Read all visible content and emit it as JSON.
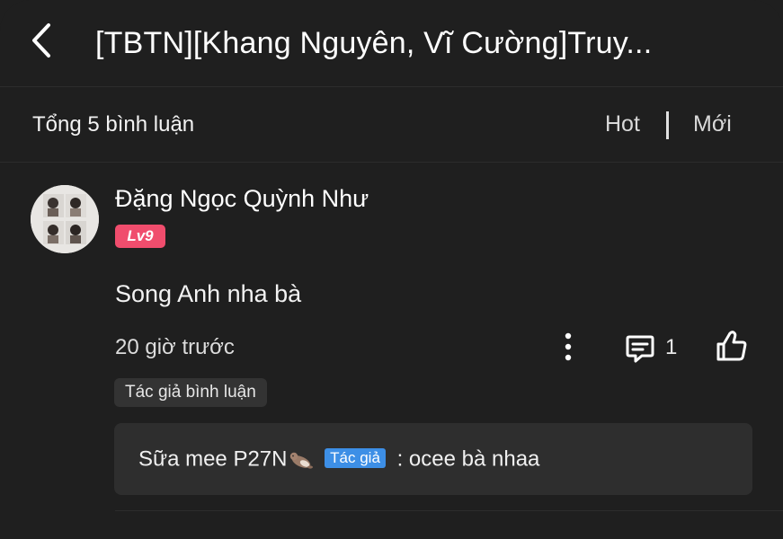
{
  "header": {
    "title": "[TBTN][Khang Nguyên, Vĩ Cường]Truy...",
    "back_icon": "chevron-left-icon"
  },
  "comments_bar": {
    "count_text": "Tổng 5 bình luận",
    "sort_hot": "Hot",
    "sort_new": "Mới"
  },
  "comment": {
    "username": "Đặng Ngọc Quỳnh Như",
    "level": "Lv9",
    "text": "Song Anh nha bà",
    "time": "20 giờ trước",
    "reply_count": "1",
    "author_chip": "Tác giả bình luận",
    "reply": {
      "name": "Sữa mee P27N",
      "tag": "Tác giả",
      "separator": ":",
      "text": "ocee bà nhaa"
    }
  },
  "icons": {
    "more": "more-vertical-icon",
    "reply": "comment-icon",
    "like": "thumbs-up-icon",
    "emoji": "otter-emoji-icon"
  },
  "colors": {
    "background": "#1f1f1f",
    "level_badge": "#f04d6d",
    "author_tag": "#3d8fe6",
    "reply_box": "#2e2e2e"
  }
}
